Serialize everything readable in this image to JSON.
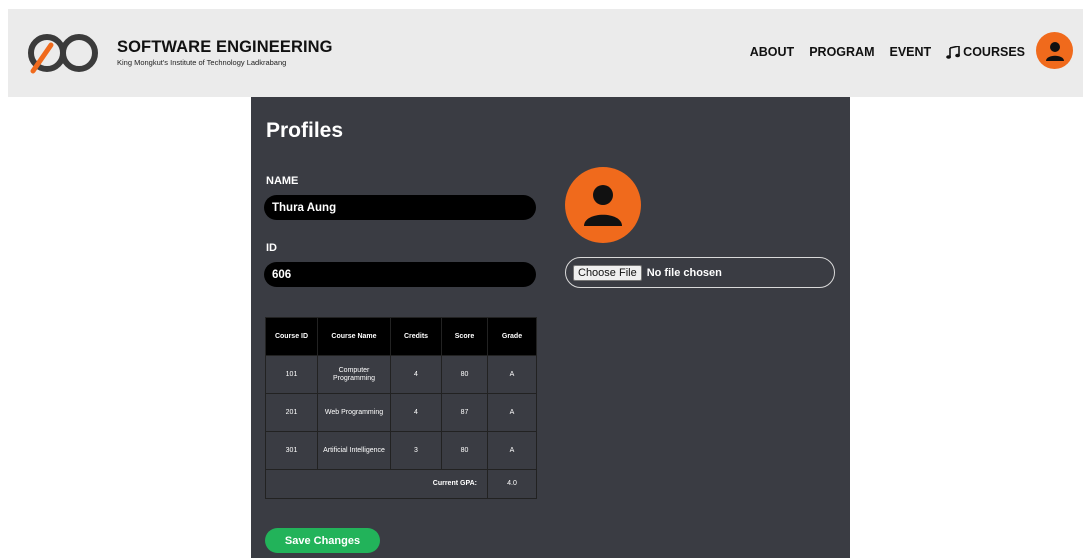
{
  "header": {
    "brand_title": "SOFTWARE ENGINEERING",
    "brand_subtitle": "King Mongkut's Institute of Technology Ladkrabang",
    "nav": [
      {
        "label": "ABOUT"
      },
      {
        "label": "PROGRAM"
      },
      {
        "label": "EVENT"
      },
      {
        "label": "COURSES",
        "icon": "music-note-icon"
      }
    ],
    "profile_icon": "user-avatar-icon"
  },
  "profile": {
    "title": "Profiles",
    "name_label": "NAME",
    "name_value": "Thura Aung",
    "id_label": "ID",
    "id_value": "606",
    "avatar_icon": "user-avatar-icon",
    "file_button": "Choose File",
    "file_status": "No file chosen",
    "save_button": "Save Changes"
  },
  "grades_table": {
    "headers": [
      "Course ID",
      "Course Name",
      "Credits",
      "Score",
      "Grade"
    ],
    "rows": [
      [
        "101",
        "Computer Programming",
        "4",
        "80",
        "A"
      ],
      [
        "201",
        "Web Programming",
        "4",
        "87",
        "A"
      ],
      [
        "301",
        "Artificial Intelligence",
        "3",
        "80",
        "A"
      ]
    ],
    "gpa_label": "Current GPA:",
    "gpa_value": "4.0"
  },
  "colors": {
    "accent": "#f06a1c",
    "panel": "#3a3c43",
    "navbar": "#ebebeb",
    "save": "#22b35a"
  }
}
